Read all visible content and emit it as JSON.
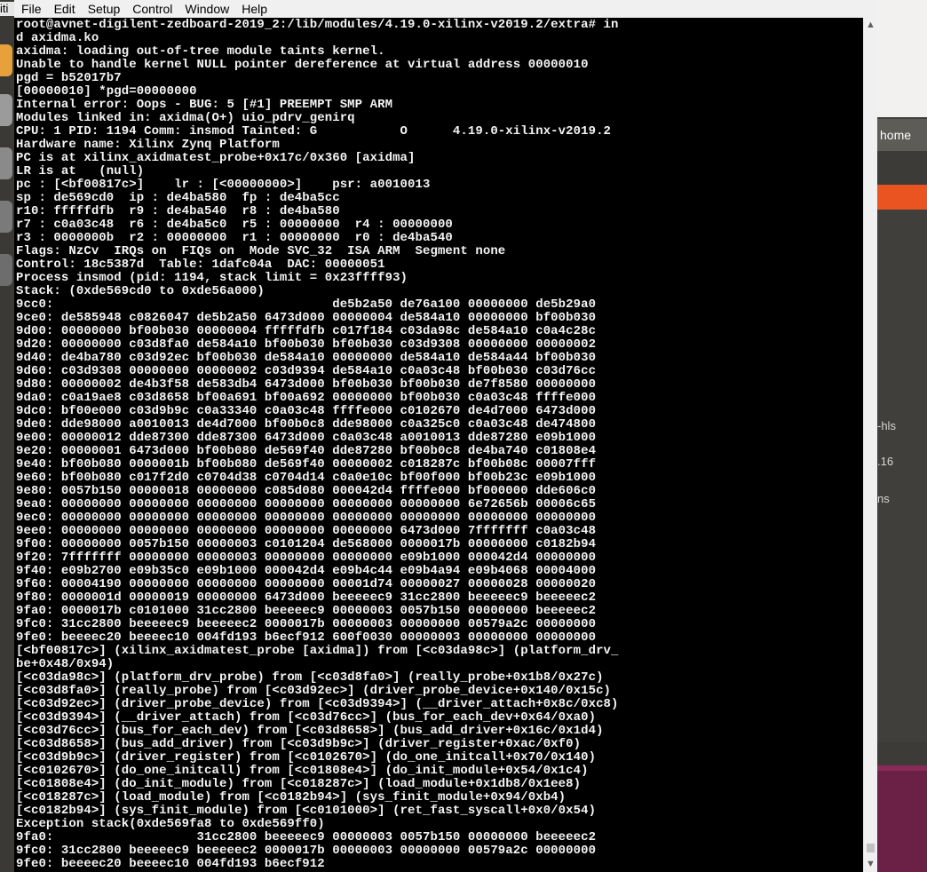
{
  "menubar": {
    "partial_left": "iti",
    "items": [
      "File",
      "Edit",
      "Setup",
      "Control",
      "Window",
      "Help"
    ]
  },
  "background": {
    "home_label": "home",
    "label_hls": "-hls",
    "label_16": ".16",
    "label_ns": "ns"
  },
  "terminal": {
    "lines": [
      "root@avnet-digilent-zedboard-2019_2:/lib/modules/4.19.0-xilinx-v2019.2/extra# in",
      "d axidma.ko",
      "axidma: loading out-of-tree module taints kernel.",
      "Unable to handle kernel NULL pointer dereference at virtual address 00000010",
      "pgd = b52017b7",
      "[00000010] *pgd=00000000",
      "Internal error: Oops - BUG: 5 [#1] PREEMPT SMP ARM",
      "Modules linked in: axidma(O+) uio_pdrv_genirq",
      "CPU: 1 PID: 1194 Comm: insmod Tainted: G           O      4.19.0-xilinx-v2019.2",
      "Hardware name: Xilinx Zynq Platform",
      "PC is at xilinx_axidmatest_probe+0x17c/0x360 [axidma]",
      "LR is at   (null)",
      "pc : [<bf00817c>]    lr : [<00000000>]    psr: a0010013",
      "sp : de569cd0  ip : de4ba580  fp : de4ba5cc",
      "r10: fffffdfb  r9 : de4ba540  r8 : de4ba580",
      "r7 : c0a03c48  r6 : de4ba5c0  r5 : 00000000  r4 : 00000000",
      "r3 : 0000000b  r2 : 00000000  r1 : 00000000  r0 : de4ba540",
      "Flags: NzCv  IRQs on  FIQs on  Mode SVC_32  ISA ARM  Segment none",
      "Control: 18c5387d  Table: 1dafc04a  DAC: 00000051",
      "Process insmod (pid: 1194, stack limit = 0x23ffff93)",
      "Stack: (0xde569cd0 to 0xde56a000)",
      "9cc0:                                     de5b2a50 de76a100 00000000 de5b29a0",
      "9ce0: de585948 c0826047 de5b2a50 6473d000 00000004 de584a10 00000000 bf00b030",
      "9d00: 00000000 bf00b030 00000004 fffffdfb c017f184 c03da98c de584a10 c0a4c28c",
      "9d20: 00000000 c03d8fa0 de584a10 bf00b030 bf00b030 c03d9308 00000000 00000002",
      "9d40: de4ba780 c03d92ec bf00b030 de584a10 00000000 de584a10 de584a44 bf00b030",
      "9d60: c03d9308 00000000 00000002 c03d9394 de584a10 c0a03c48 bf00b030 c03d76cc",
      "9d80: 00000002 de4b3f58 de583db4 6473d000 bf00b030 bf00b030 de7f8580 00000000",
      "9da0: c0a19ae8 c03d8658 bf00a691 bf00a692 00000000 bf00b030 c0a03c48 ffffe000",
      "9dc0: bf00e000 c03d9b9c c0a33340 c0a03c48 ffffe000 c0102670 de4d7000 6473d000",
      "9de0: dde98000 a0010013 de4d7000 bf00b0c8 dde98000 c0a325c0 c0a03c48 de474800",
      "9e00: 00000012 dde87300 dde87300 6473d000 c0a03c48 a0010013 dde87280 e09b1000",
      "9e20: 00000001 6473d000 bf00b080 de569f40 dde87280 bf00b0c8 de4ba740 c01808e4",
      "9e40: bf00b080 0000001b bf00b080 de569f40 00000002 c018287c bf00b08c 00007fff",
      "9e60: bf00b080 c017f2d0 c0704d38 c0704d14 c0a0e10c bf00f000 bf00b23c e09b1000",
      "9e80: 0057b150 00000018 00000000 c085d080 000042d4 ffffe000 bf000000 dde606c0",
      "9ea0: 00000000 00000000 00000000 00000000 00000000 00000000 6e72656b 00006c65",
      "9ec0: 00000000 00000000 00000000 00000000 00000000 00000000 00000000 00000000",
      "9ee0: 00000000 00000000 00000000 00000000 00000000 6473d000 7fffffff c0a03c48",
      "9f00: 00000000 0057b150 00000003 c0101204 de568000 0000017b 00000000 c0182b94",
      "9f20: 7fffffff 00000000 00000003 00000000 00000000 e09b1000 000042d4 00000000",
      "9f40: e09b2700 e09b35c0 e09b1000 000042d4 e09b4c44 e09b4a94 e09b4068 00004000",
      "9f60: 00004190 00000000 00000000 00000000 00001d74 00000027 00000028 00000020",
      "9f80: 0000001d 00000019 00000000 6473d000 beeeeec9 31cc2800 beeeeec9 beeeeec2",
      "9fa0: 0000017b c0101000 31cc2800 beeeeec9 00000003 0057b150 00000000 beeeeec2",
      "9fc0: 31cc2800 beeeeec9 beeeeec2 0000017b 00000003 00000000 00579a2c 00000000",
      "9fe0: beeeec20 beeeec10 004fd193 b6ecf912 600f0030 00000003 00000000 00000000",
      "[<bf00817c>] (xilinx_axidmatest_probe [axidma]) from [<c03da98c>] (platform_drv_",
      "be+0x48/0x94)",
      "[<c03da98c>] (platform_drv_probe) from [<c03d8fa0>] (really_probe+0x1b8/0x27c)",
      "[<c03d8fa0>] (really_probe) from [<c03d92ec>] (driver_probe_device+0x140/0x15c)",
      "[<c03d92ec>] (driver_probe_device) from [<c03d9394>] (__driver_attach+0x8c/0xc8)",
      "[<c03d9394>] (__driver_attach) from [<c03d76cc>] (bus_for_each_dev+0x64/0xa0)",
      "[<c03d76cc>] (bus_for_each_dev) from [<c03d8658>] (bus_add_driver+0x16c/0x1d4)",
      "[<c03d8658>] (bus_add_driver) from [<c03d9b9c>] (driver_register+0xac/0xf0)",
      "[<c03d9b9c>] (driver_register) from [<c0102670>] (do_one_initcall+0x70/0x140)",
      "[<c0102670>] (do_one_initcall) from [<c01808e4>] (do_init_module+0x54/0x1c4)",
      "[<c01808e4>] (do_init_module) from [<c018287c>] (load_module+0x1db8/0x1ee8)",
      "[<c018287c>] (load_module) from [<c0182b94>] (sys_finit_module+0x94/0xb4)",
      "[<c0182b94>] (sys_finit_module) from [<c0101000>] (ret_fast_syscall+0x0/0x54)",
      "Exception stack(0xde569fa8 to 0xde569ff0)",
      "9fa0:                   31cc2800 beeeeec9 00000003 0057b150 00000000 beeeeec2",
      "9fc0: 31cc2800 beeeeec9 beeeeec2 0000017b 00000003 00000000 00579a2c 00000000",
      "9fe0: beeeec20 beeeec10 004fd193 b6ecf912"
    ]
  },
  "scrollbar": {
    "up_icon": "▲",
    "down_icon": "▼"
  },
  "colors": {
    "terminal_bg": "#000000",
    "terminal_fg": "#f4f4f4",
    "menubar_bg": "#f0f0f0",
    "accent_orange": "#e95420",
    "accent_magenta": "#6b2145"
  }
}
